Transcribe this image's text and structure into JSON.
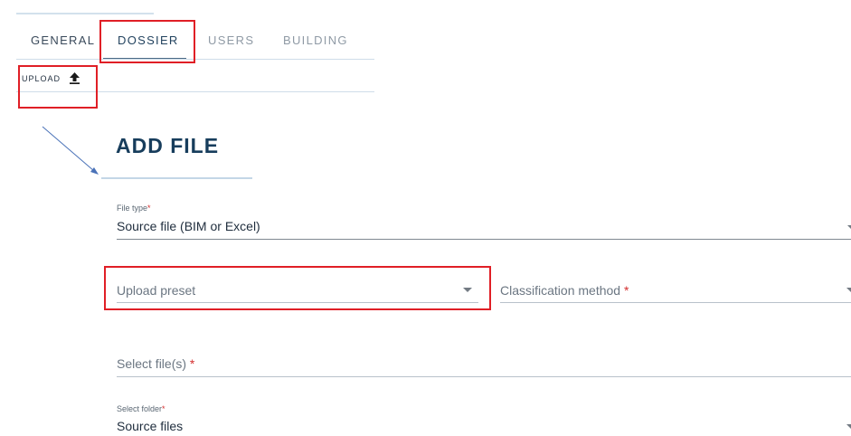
{
  "tabs": [
    {
      "label": "GENERAL"
    },
    {
      "label": "DOSSIER"
    },
    {
      "label": "USERS"
    },
    {
      "label": "BUILDING"
    }
  ],
  "upload": {
    "label": "UPLOAD",
    "icon": "upload-icon"
  },
  "page_title": "ADD FILE",
  "form": {
    "file_type": {
      "label": "File type",
      "required_mark": "*",
      "value": "Source file (BIM or Excel)"
    },
    "upload_preset": {
      "placeholder": "Upload preset"
    },
    "classification_method": {
      "placeholder": "Classification method",
      "required_mark": "*"
    },
    "select_files": {
      "placeholder": "Select file(s)",
      "required_mark": "*"
    },
    "select_folder": {
      "label": "Select folder",
      "required_mark": "*",
      "value": "Source files"
    }
  },
  "colors": {
    "title": "#173d5c",
    "tab_active": "#23435f",
    "tab_inactive": "#8f9aa5",
    "highlight": "#e01f26",
    "required": "#d32f2f",
    "arrow": "#4a72b8"
  }
}
